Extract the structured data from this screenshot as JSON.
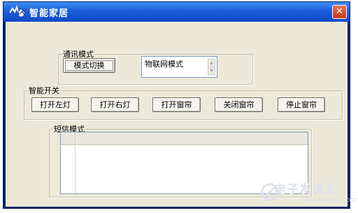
{
  "window": {
    "title": "智能家居",
    "close_glyph": "✕"
  },
  "comm_mode": {
    "legend": "通讯模式",
    "switch_button": "模式切换",
    "mode_value": "物联网模式"
  },
  "smart_switch": {
    "legend": "智能开关",
    "buttons": [
      "打开左灯",
      "打开右灯",
      "打开窗帘",
      "关闭窗帘",
      "停止窗帘"
    ]
  },
  "sms_mode": {
    "legend": "短信模式"
  },
  "watermark": {
    "text": "电子发烧友",
    "url": "www.elecfans.com"
  },
  "colors": {
    "titlebar": "#0e48c8",
    "client": "#ece9d8",
    "close": "#c4391f"
  }
}
